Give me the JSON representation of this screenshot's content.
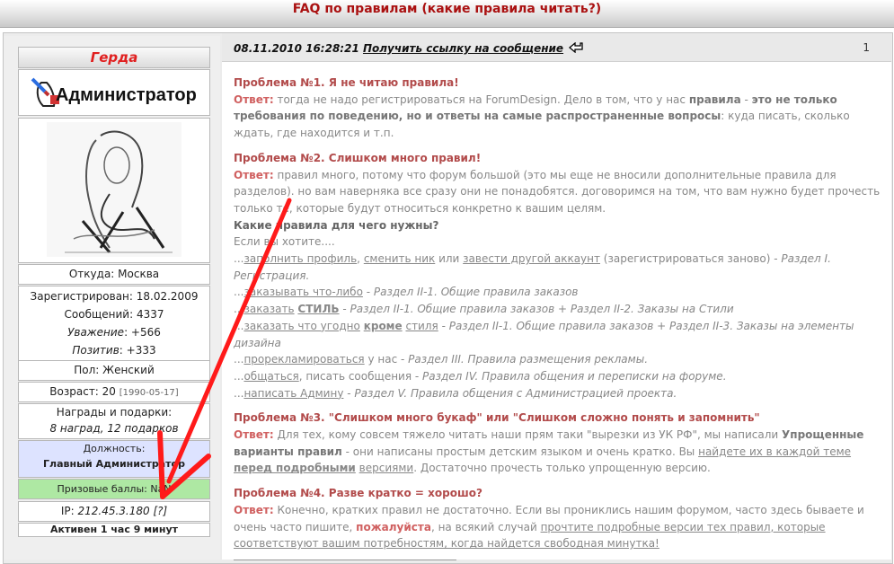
{
  "header": {
    "title": "FAQ по правилам (какие правила читать?)"
  },
  "user": {
    "nick": "Герда",
    "rank_label": "Администратор",
    "from": "Откуда: Москва",
    "registered": "Зарегистрирован: 18.02.2009",
    "messages": "Сообщений: 4337",
    "respect_label": "Уважение",
    "respect_value": ": +566",
    "positive_label": "Позитив",
    "positive_value": ": +333",
    "sex": "Пол: Женский",
    "age": "Возраст: 20",
    "age_date": "[1990-05-17]",
    "awards_title": "Награды и подарки:",
    "awards_value": "8 наград, 12 подарков",
    "post_title": "Должность:",
    "post_value": "Главный Администратор",
    "prize": "Призовые баллы: NaN",
    "ip_label": "IP: ",
    "ip_value": "212.45.3.180 [?]",
    "active": "Активен 1 час 9 минут"
  },
  "post": {
    "date": "08.11.2010 16:28:21",
    "link": "Получить ссылку на сообщение",
    "number": "1",
    "p1": {
      "title": "Проблема №1. Я не читаю правила!",
      "ans": "Ответ:",
      "t1": " тогда не надо регистрироваться на ForumDesign. Дело в том, что у нас ",
      "b1": "правила",
      "t2": " - ",
      "b2": "это не только требования по поведению, но и ответы на самые распространенные вопросы",
      "t3": ": куда писать, сколько ждать, где находится и т.п."
    },
    "p2": {
      "title": "Проблема №2. Слишком много правил!",
      "ans": "Ответ:",
      "t1": " правил много, потому что форум большой (это мы еще не вносили дополнительные правила для разделов). но вам наверняка все сразу они не понадобятся. договоримся на том, что вам нужно будет прочесть только те, которые будут относиться конкретно к вашим целям.",
      "sub": "Какие правила для чего нужны?",
      "intro": "Если вы хотите....",
      "l1a": "заполнить профиль",
      "l1b": "сменить ник",
      "l1c": "завести другой аккаунт",
      "l1d": " (зарегистрироваться заново) - ",
      "l1e": "Раздел I. Регистрация.",
      "l2a": "заказывать что-либо",
      "l2b": "Раздел II-1. Общие правила заказов",
      "l3a": "заказать",
      "l3b": "СТИЛЬ",
      "l3c": "Раздел II-1. Общие правила заказов + Раздел II-2. Заказы на Стили",
      "l4a": "заказать что угодно",
      "l4b": "кроме",
      "l4c": "стиля",
      "l4d": "Раздел II-1. Общие правила заказов + Раздел II-3. Заказы на элементы дизайна",
      "l5a": "прорекламироваться",
      "l5b": " у нас - ",
      "l5c": "Раздел III. Правила размещения рекламы.",
      "l6a": "общаться",
      "l6b": ", писать сообщения - ",
      "l6c": "Раздел IV. Правила общения и переписки на форуме.",
      "l7a": "написать Админу",
      "l7b": "Раздел V. Правила общения с Администрацией проекта."
    },
    "p3": {
      "title": "Проблема №3. \"Слишком много букаф\" или \"Слишком сложно понять и запомнить\"",
      "ans": "Ответ:",
      "t1": " Для тех, кому совсем тяжело читать наши прям таки \"вырезки из УК РФ\", мы написали ",
      "b1": "Упрощенные варианты правил",
      "t2": " - они написаны простым детским языком и очень кратко. Вы ",
      "l1": "найдете их в каждой теме",
      "l2": "перед подробными",
      "l3": "версиями",
      "t3": ". Достаточно прочесть только упрощенную версию."
    },
    "p4": {
      "title": "Проблема №4. Разве кратко = хорошо?",
      "ans": "Ответ:",
      "t1": " Конечно, кратких правил не достаточно. Если вы прониклись нашим форумом, часто здесь бываете и очень часто пишите, ",
      "b1": "пожалуйста",
      "t2": ", на всякий случай ",
      "l1": "прочтите подробные версии тех правил, которые соответствуют вашим потребностям, когда найдется свободная минутка!"
    }
  },
  "colors": {
    "title_red": "#aa1111",
    "nick_red": "#e02020",
    "arrow_red": "#ff1a1a",
    "heading_red": "#b24b4b",
    "post_blue": "#dde3ff",
    "prize_green": "#aee8a3"
  }
}
